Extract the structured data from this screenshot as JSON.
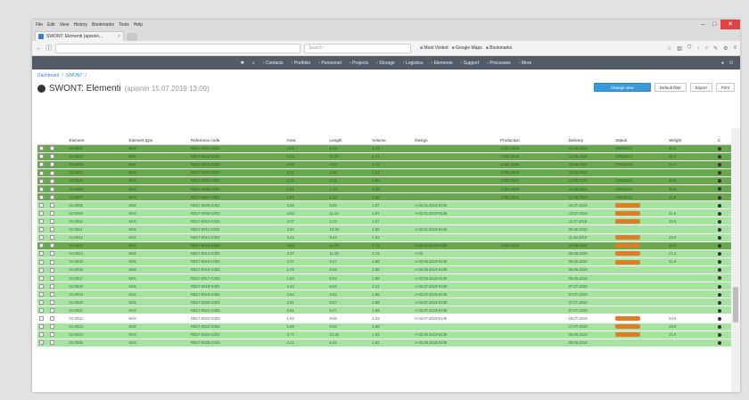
{
  "browser": {
    "menu": [
      "File",
      "Edit",
      "View",
      "History",
      "Bookmarks",
      "Tools",
      "Help"
    ],
    "tab_title": "SWONT: Elementi (apisnin...",
    "url": "",
    "search_placeholder": "Search",
    "bookmarks": [
      "Most Visited",
      "Google Maps",
      "Bookmarks"
    ]
  },
  "app": {
    "nav": [
      "Contacts",
      "Portfolio",
      "Personnel",
      "Projects",
      "Storage",
      "Logistics",
      "Elements",
      "Support",
      "Processes",
      "More"
    ],
    "breadcrumb": [
      "Dashboard",
      "SWONT"
    ],
    "title": "SWONT: Elementi",
    "subtitle": "(apisnin 15.07.2019 13:09)",
    "actions": {
      "primary": "Change view",
      "secondary": "Default filter",
      "export": "Export",
      "print": "Print"
    }
  },
  "table": {
    "columns": [
      "Element",
      "Element type",
      "Reference code",
      "Area",
      "Length",
      "Volume",
      "Design",
      "Production",
      "Delivery",
      "Status",
      "Weight",
      "C"
    ],
    "rows": [
      {
        "type": "dark",
        "id": "01-0001",
        "cat": "KKE",
        "code": "RB17-0001-C003",
        "a": "3.62",
        "b": "5.44",
        "c": "1.74",
        "design": "",
        "prod": "1.002.2019",
        "del": "12.06.2019",
        "status": "OW02013",
        "w": "30.2"
      },
      {
        "type": "dark",
        "id": "01-0002",
        "cat": "KKE",
        "code": "RB17-0002-C003",
        "a": "2.41",
        "b": "11.20",
        "c": "1.74",
        "design": "",
        "prod": "1.002.2019",
        "del": "12.06.2019",
        "status": "OW02013",
        "w": "30.2"
      },
      {
        "type": "dark",
        "id": "01-0003",
        "cat": "KKE",
        "code": "RB17-0003-C003",
        "a": "3.90",
        "b": "4.44",
        "c": "1.74",
        "design": "",
        "prod": "1.002.2019",
        "del": "12.06.2019",
        "status": "OW02013",
        "w": "21.7"
      },
      {
        "type": "dark",
        "id": "01-0004",
        "cat": "KKE",
        "code": "RB17-0004-C003",
        "a": "2.31",
        "b": "4.30",
        "c": "2.41",
        "design": "",
        "prod": "1.003.2019",
        "del": "12.06.2019",
        "status": "",
        "w": ""
      },
      {
        "type": "dark",
        "id": "01-0005",
        "cat": "KKE",
        "code": "RB17-0005-C003",
        "a": "3.11",
        "b": "3.14",
        "c": "2.80",
        "design": "",
        "prod": "1.003.2019",
        "del": "12.06.2019",
        "status": "OW02013",
        "w": "30.8"
      },
      {
        "type": "dark",
        "id": "01-0006",
        "cat": "KKE",
        "code": "RB17-0006-C003",
        "a": "2.91",
        "b": "1.23",
        "c": "2.48",
        "design": "",
        "prod": "1.003.2019",
        "del": "12.06.2019",
        "status": "OW02013",
        "w": "30.8"
      },
      {
        "type": "dark",
        "id": "01-0007",
        "cat": "KKE",
        "code": "RB17-0007-C003",
        "a": "2.91",
        "b": "1.23",
        "c": "2.48",
        "design": "",
        "prod": "1.003.2019",
        "del": "12.06.2019",
        "status": "OW02013",
        "w": "21.9"
      },
      {
        "type": "light",
        "id": "01-0008",
        "cat": "KKE",
        "code": "RB17-0008-C003",
        "a": "3.82",
        "b": "8.89",
        "c": "1.87",
        "design": "A-02.01.2019-0139",
        "prod": "",
        "del": "10.07.2019",
        "status": "pill",
        "w": ""
      },
      {
        "type": "light",
        "id": "01-0009",
        "cat": "KKE",
        "code": "RB17-0009-C003",
        "a": "3.83",
        "b": "11.20",
        "c": "1.87",
        "design": "A-02.01.2019-0139",
        "prod": "",
        "del": "10.07.2019",
        "status": "pill",
        "w": "21.0"
      },
      {
        "type": "light",
        "id": "01-0010",
        "cat": "KKE",
        "code": "RB17-0010-C003",
        "a": "3.37",
        "b": "3.13",
        "c": "1.87",
        "design": "",
        "prod": "",
        "del": "11.07.2019",
        "status": "pill",
        "w": "19.0"
      },
      {
        "type": "light",
        "id": "01-0011",
        "cat": "KKE",
        "code": "RB17-0011-C003",
        "a": "3.84",
        "b": "10.20",
        "c": "1.85",
        "design": "A-02.01.2019-0139",
        "prod": "",
        "del": "05.06.2019",
        "status": "",
        "w": ""
      },
      {
        "type": "light",
        "id": "01-0012",
        "cat": "KKE",
        "code": "RB17-0012-C003",
        "a": "3.42",
        "b": "9.44",
        "c": "1.92",
        "design": "",
        "prod": "",
        "del": "11.05.2019",
        "status": "pill",
        "w": "19.0"
      },
      {
        "type": "dark",
        "id": "01-0013",
        "cat": "KKE",
        "code": "RB17-0013-C003",
        "a": "3.84",
        "b": "11.20",
        "c": "1.74",
        "design": "A-02.01.2019-0139",
        "prod": "1.002.2019",
        "del": "12.06.2019",
        "status": "pill",
        "w": "30.2"
      },
      {
        "type": "light",
        "id": "01-0014",
        "cat": "KKE",
        "code": "RB17-0014-C003",
        "a": "3.37",
        "b": "11.20",
        "c": "1.74",
        "design": "A-03",
        "prod": "",
        "del": "05.06.2019",
        "status": "pill",
        "w": "21.4"
      },
      {
        "type": "light",
        "id": "01-0015",
        "cat": "KKE",
        "code": "RB17-0015-C003",
        "a": "3.37",
        "b": "8.47",
        "c": "1.88",
        "design": "A-02.06.2019-0139",
        "prod": "",
        "del": "05.05.2019",
        "status": "pill",
        "w": "21.6"
      },
      {
        "type": "light",
        "id": "01-0016",
        "cat": "KKE",
        "code": "RB17-0016-C003",
        "a": "1.79",
        "b": "8.04",
        "c": "1.88",
        "design": "A-02.06.2019-0139",
        "prod": "",
        "del": "05.05.2019",
        "status": "",
        "w": ""
      },
      {
        "type": "light",
        "id": "01-0017",
        "cat": "KKE",
        "code": "RB17-0017-C003",
        "a": "1.84",
        "b": "8.04",
        "c": "1.88",
        "design": "A-02.06.2019-0139",
        "prod": "",
        "del": "05.05.2019",
        "status": "",
        "w": ""
      },
      {
        "type": "light",
        "id": "01-0018",
        "cat": "KKE",
        "code": "RB17-0018-C003",
        "a": "3.42",
        "b": "8.04",
        "c": "1.21",
        "design": "A-02.07.2019-0139",
        "prod": "",
        "del": "07.07.2019",
        "status": "",
        "w": ""
      },
      {
        "type": "light",
        "id": "01-0019",
        "cat": "KKE",
        "code": "RB17-0019-C003",
        "a": "2.84",
        "b": "8.64",
        "c": "1.88",
        "design": "A-02.07.2019-0139",
        "prod": "",
        "del": "07.07.2019",
        "status": "",
        "w": ""
      },
      {
        "type": "light",
        "id": "01-0020",
        "cat": "KKE",
        "code": "RB17-0020-C003",
        "a": "2.81",
        "b": "8.07",
        "c": "1.88",
        "design": "A-02.07.2019-0139",
        "prod": "",
        "del": "07.07.2019",
        "status": "",
        "w": ""
      },
      {
        "type": "light",
        "id": "01-0021",
        "cat": "KKE",
        "code": "RB17-0021-C003",
        "a": "2.81",
        "b": "8.07",
        "c": "1.88",
        "design": "A-02.07.2019-0139",
        "prod": "",
        "del": "07.07.2019",
        "status": "",
        "w": ""
      },
      {
        "type": "white",
        "id": "01-0022",
        "cat": "KKE",
        "code": "RB17-0022-C003",
        "a": "1.82",
        "b": "8.06",
        "c": "1.23",
        "design": "A-02.07.2019-0139",
        "prod": "",
        "del": "19.07.2019",
        "status": "pill",
        "w": "24.3"
      },
      {
        "type": "light",
        "id": "01-0023",
        "cat": "KKE",
        "code": "RB17-0023-C003",
        "a": "1.89",
        "b": "8.04",
        "c": "1.88",
        "design": "",
        "prod": "",
        "del": "17.07.2019",
        "status": "pill",
        "w": "18.0"
      },
      {
        "type": "light",
        "id": "01-0024",
        "cat": "KKE",
        "code": "RB17-0024-C003",
        "a": "3.77",
        "b": "10.20",
        "c": "1.93",
        "design": "A-02.06.2019-0139",
        "prod": "",
        "del": "05.06.2019",
        "status": "pill",
        "w": "21.0"
      },
      {
        "type": "light",
        "id": "01-0025",
        "cat": "KKE",
        "code": "RB17-0025-C003",
        "a": "3.41",
        "b": "8.44",
        "c": "1.92",
        "design": "A-02.06.2019-0139",
        "prod": "",
        "del": "05.06.2019",
        "status": "",
        "w": ""
      }
    ]
  },
  "colors": {
    "dark_row": "#6aa84f",
    "light_row": "#a6e3a1",
    "accent": "#3a9ad9",
    "status_pill": "#e07c25",
    "appbar": "#525c68"
  }
}
